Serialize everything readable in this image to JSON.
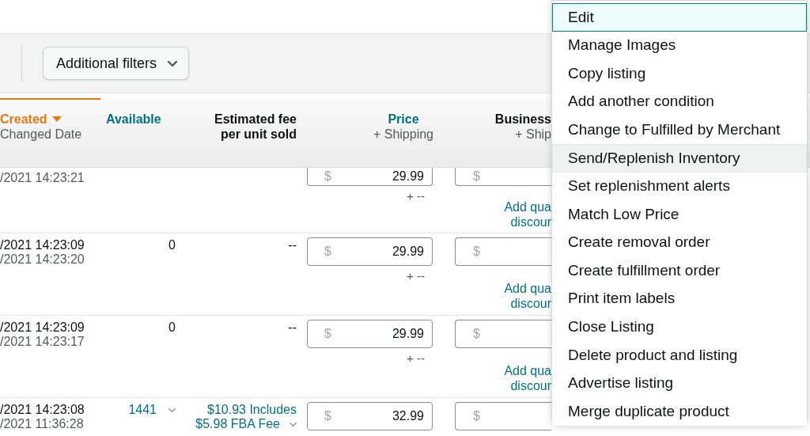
{
  "filter_bar": {
    "button": "Additional filters"
  },
  "table": {
    "columns": [
      {
        "label": "Created",
        "sublabel": "Changed Date",
        "sortable": true,
        "sorted": true
      },
      {
        "label": "Available",
        "sortable": true,
        "sorted": false
      },
      {
        "label": "Estimated fee per unit sold",
        "sortable": false,
        "sorted": false
      },
      {
        "label": "Price",
        "sublabel": "+ Shipping",
        "sortable": true,
        "sorted": false
      },
      {
        "label": "Business",
        "sublabel": "+ Ship",
        "sortable": false,
        "sorted": false
      }
    ],
    "rows": [
      {
        "cut_off": true,
        "changed": "/2021 14:23:21",
        "price": {
          "currency": "$",
          "value": "29.99",
          "shipping": "+ --"
        },
        "business": {
          "currency": "$",
          "link": [
            "Add qua",
            "discour"
          ]
        }
      },
      {
        "cut_off": false,
        "created": "/2021 14:23:09",
        "changed": "/2021 14:23:20",
        "available": {
          "kind": "plain",
          "value": "0"
        },
        "fee": {
          "kind": "plain",
          "lines": [
            "--"
          ]
        },
        "price": {
          "currency": "$",
          "value": "29.99",
          "shipping": "+ --"
        },
        "business": {
          "currency": "$",
          "link": [
            "Add qua",
            "discour"
          ]
        }
      },
      {
        "cut_off": false,
        "created": "/2021 14:23:09",
        "changed": "/2021 14:23:17",
        "available": {
          "kind": "plain",
          "value": "0"
        },
        "fee": {
          "kind": "plain",
          "lines": [
            "--"
          ]
        },
        "price": {
          "currency": "$",
          "value": "29.99",
          "shipping": "+ --"
        },
        "business": {
          "currency": "$",
          "link": [
            "Add qua",
            "discour"
          ]
        }
      },
      {
        "cut_off": false,
        "created": "/2021 14:23:08",
        "changed": "/2021 11:36:28",
        "available": {
          "kind": "dropdown",
          "value": "1441"
        },
        "fee": {
          "kind": "dropdown",
          "lines": [
            "$10.93 Includes",
            "$5.98 FBA Fee"
          ]
        },
        "price": {
          "currency": "$",
          "value": "32.99"
        },
        "business": {
          "currency": "$"
        }
      }
    ]
  },
  "menu": {
    "items": [
      {
        "label": "Edit",
        "selected": true,
        "hovered": false
      },
      {
        "label": "Manage Images",
        "selected": false,
        "hovered": false
      },
      {
        "label": "Copy listing",
        "selected": false,
        "hovered": false
      },
      {
        "label": "Add another condition",
        "selected": false,
        "hovered": false
      },
      {
        "label": "Change to Fulfilled by Merchant",
        "selected": false,
        "hovered": false
      },
      {
        "label": "Send/Replenish Inventory",
        "selected": false,
        "hovered": true
      },
      {
        "label": "Set replenishment alerts",
        "selected": false,
        "hovered": false
      },
      {
        "label": "Match Low Price",
        "selected": false,
        "hovered": false
      },
      {
        "label": "Create removal order",
        "selected": false,
        "hovered": false
      },
      {
        "label": "Create fulfillment order",
        "selected": false,
        "hovered": false
      },
      {
        "label": "Print item labels",
        "selected": false,
        "hovered": false
      },
      {
        "label": "Close Listing",
        "selected": false,
        "hovered": false
      },
      {
        "label": "Delete product and listing",
        "selected": false,
        "hovered": false
      },
      {
        "label": "Advertise listing",
        "selected": false,
        "hovered": false
      },
      {
        "label": "Merge duplicate product",
        "selected": false,
        "hovered": false
      }
    ]
  }
}
